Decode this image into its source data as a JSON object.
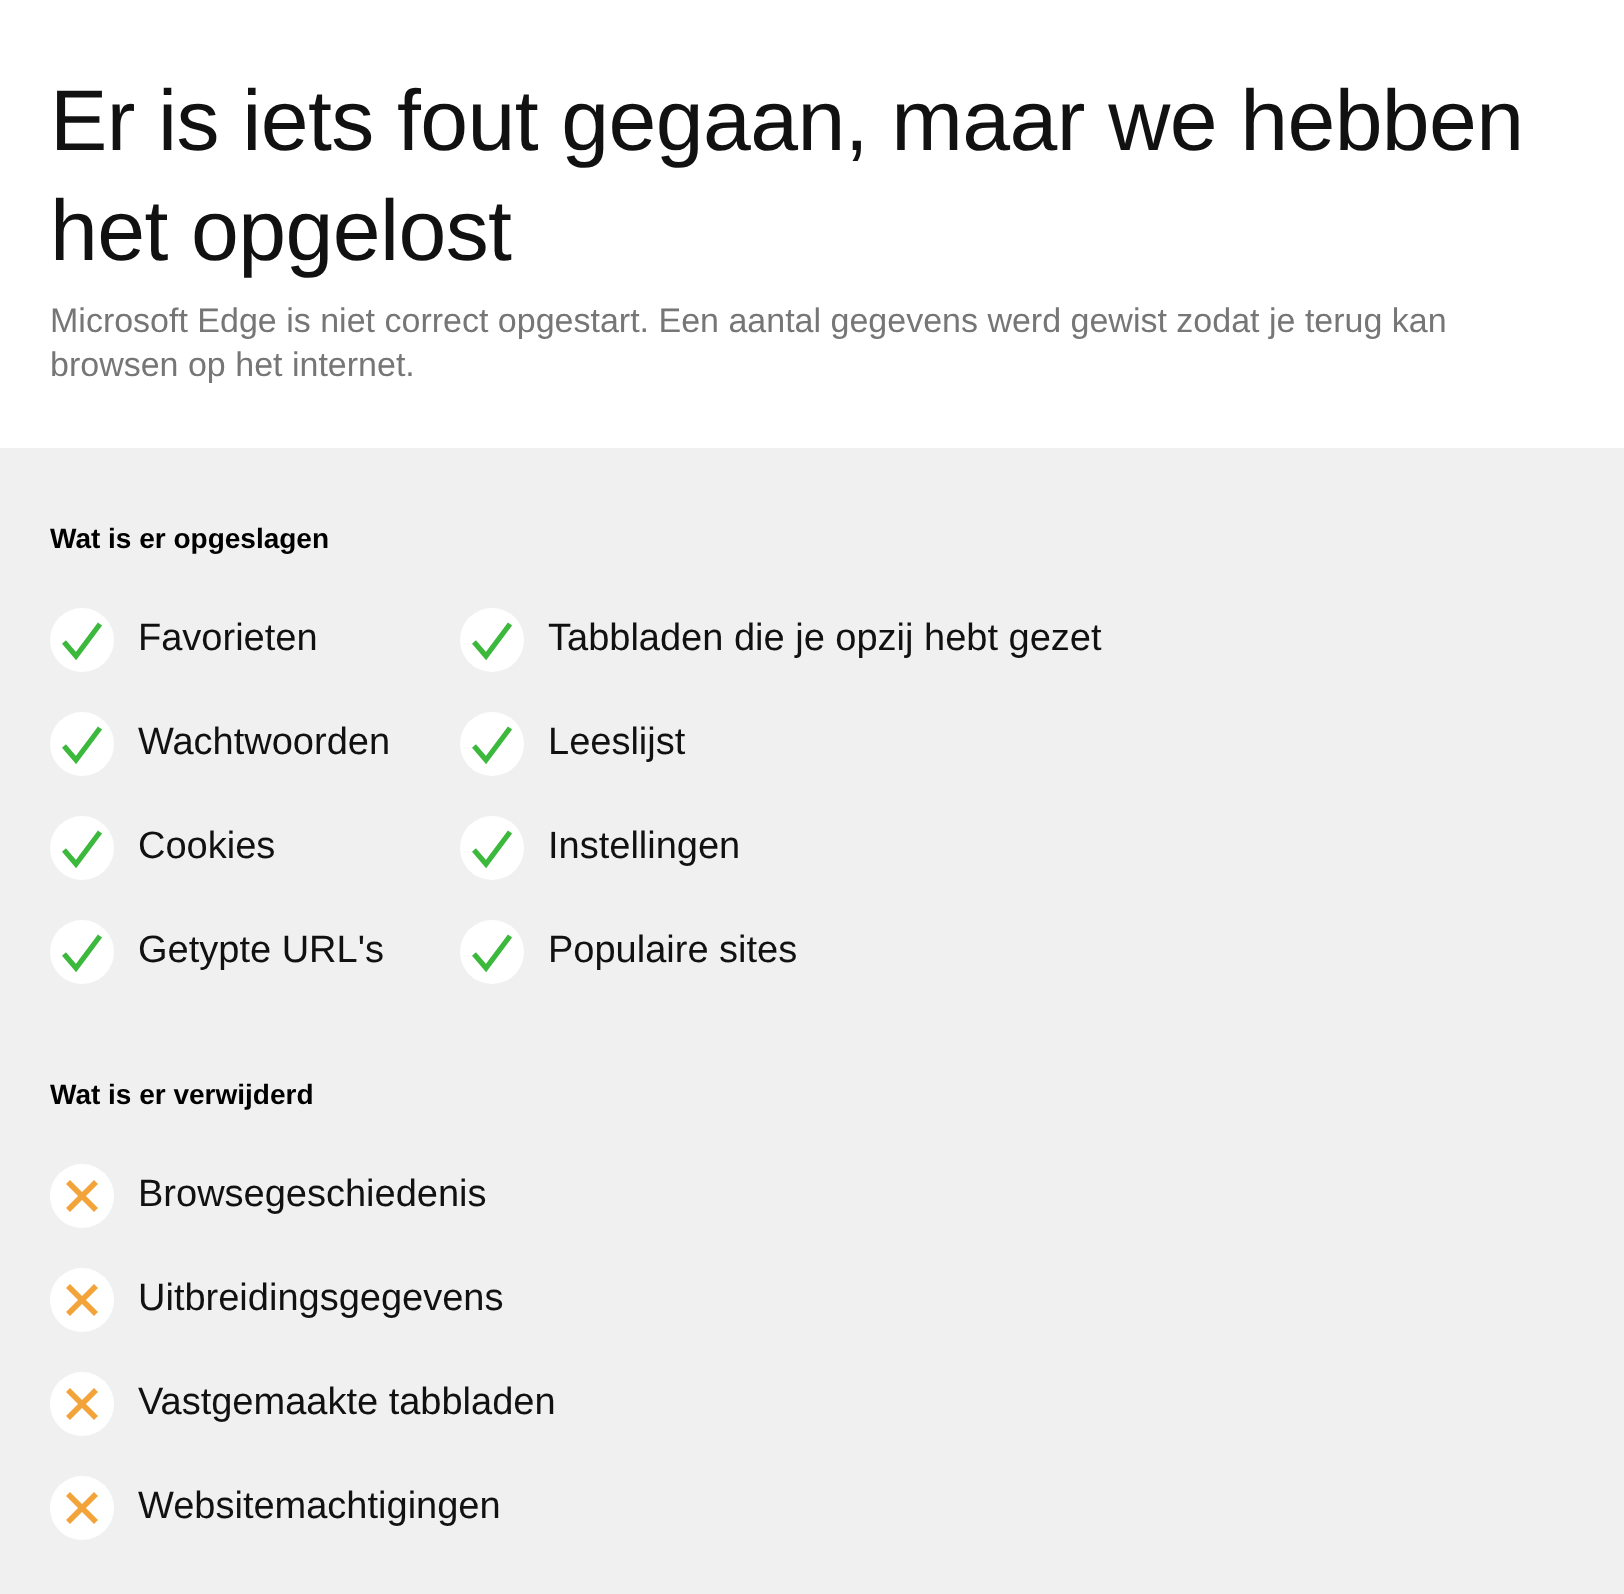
{
  "header": {
    "title": "Er is iets fout gegaan, maar we hebben het opgelost",
    "subtitle": "Microsoft Edge is niet correct opgestart. Een aantal gegevens werd gewist zodat je terug kan browsen op het internet."
  },
  "sections": [
    {
      "heading": "Wat is er opgeslagen",
      "kind": "saved",
      "columns": [
        [
          "Favorieten",
          "Wachtwoorden",
          "Cookies",
          "Getypte URL's"
        ],
        [
          "Tabbladen die je opzij hebt gezet",
          "Leeslijst",
          "Instellingen",
          "Populaire sites"
        ]
      ]
    },
    {
      "heading": "Wat is er verwijderd",
      "kind": "removed",
      "columns": [
        [
          "Browsegeschiedenis",
          "Uitbreidingsgegevens",
          "Vastgemaakte tabbladen",
          "Websitemachtigingen"
        ]
      ]
    }
  ]
}
